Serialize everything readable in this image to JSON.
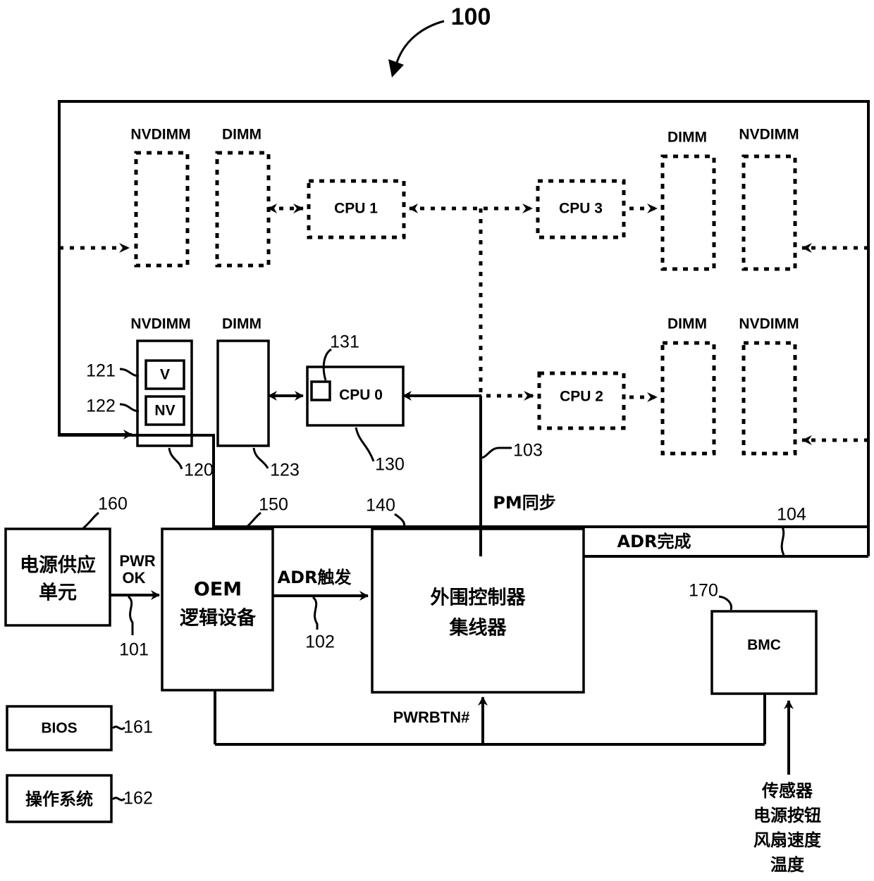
{
  "figure": {
    "number": "100"
  },
  "memory_modules": {
    "top_left": [
      {
        "label": "NVDIMM"
      },
      {
        "label": "DIMM"
      }
    ],
    "top_right": [
      {
        "label": "DIMM"
      },
      {
        "label": "NVDIMM"
      }
    ],
    "bottom_left": [
      {
        "label": "NVDIMM",
        "ref": "120"
      },
      {
        "label": "DIMM",
        "ref": "123"
      }
    ],
    "bottom_right": [
      {
        "label": "DIMM"
      },
      {
        "label": "NVDIMM"
      }
    ]
  },
  "nvdimm_detail": {
    "volatile": {
      "label": "V",
      "ref": "121"
    },
    "nonvolatile": {
      "label": "NV",
      "ref": "122"
    }
  },
  "cpus": [
    {
      "label": "CPU 1"
    },
    {
      "label": "CPU 3"
    },
    {
      "label": "CPU 0",
      "ref": "130",
      "port_ref": "131"
    },
    {
      "label": "CPU 2"
    }
  ],
  "blocks": {
    "power_supply": {
      "label_line1": "电源供应",
      "label_line2": "单元",
      "ref": "160"
    },
    "oem_logic": {
      "label_line1": "OEM",
      "label_line2": "逻辑设备",
      "ref": "150"
    },
    "pch": {
      "label_line1": "外围控制器",
      "label_line2": "集线器",
      "ref": "140"
    },
    "bmc": {
      "label": "BMC",
      "ref": "170"
    },
    "bios": {
      "label": "BIOS",
      "ref": "161"
    },
    "os": {
      "label": "操作系统",
      "ref": "162"
    }
  },
  "signals": {
    "pwr_ok": {
      "line1": "PWR",
      "line2": "OK",
      "ref": "101"
    },
    "adr_trigger": {
      "label": "ADR触发",
      "ref": "102"
    },
    "pm_sync": {
      "label": "PM同步",
      "ref": "103"
    },
    "adr_complete": {
      "label": "ADR完成",
      "ref": "104"
    },
    "pwrbtn": {
      "label": "PWRBTN#"
    }
  },
  "sensor_inputs": {
    "line1": "传感器",
    "line2": "电源按钮",
    "line3": "风扇速度",
    "line4": "温度"
  }
}
